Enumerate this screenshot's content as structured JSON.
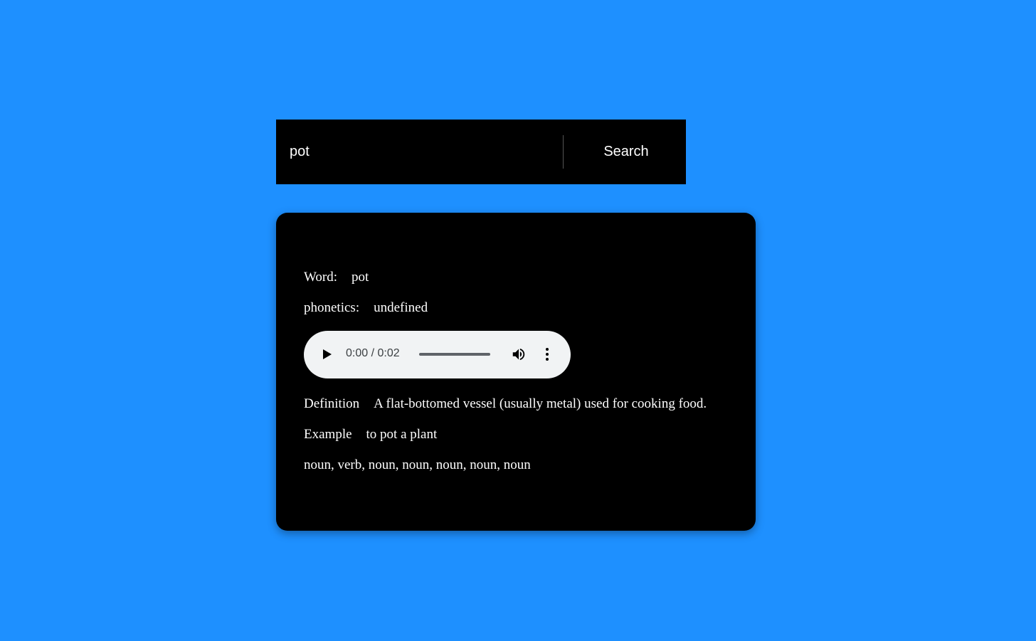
{
  "search": {
    "input_value": "pot",
    "button_label": "Search"
  },
  "result": {
    "word_label": "Word:",
    "word_value": "pot",
    "phonetics_label": "phonetics:",
    "phonetics_value": "undefined",
    "audio": {
      "time": "0:00 / 0:02",
      "progress": 0,
      "icons": [
        "play-icon",
        "volume-icon",
        "more-options-icon"
      ]
    },
    "definition_label": "Definition",
    "definition_value": "A flat-bottomed vessel (usually metal) used for cooking food.",
    "example_label": "Example",
    "example_value": "to pot a plant",
    "parts_of_speech": "noun, verb, noun, noun, noun, noun, noun"
  },
  "colors": {
    "background": "#1e90ff",
    "panel": "#000000",
    "text": "#ffffff",
    "audio_background": "#f1f3f4"
  }
}
